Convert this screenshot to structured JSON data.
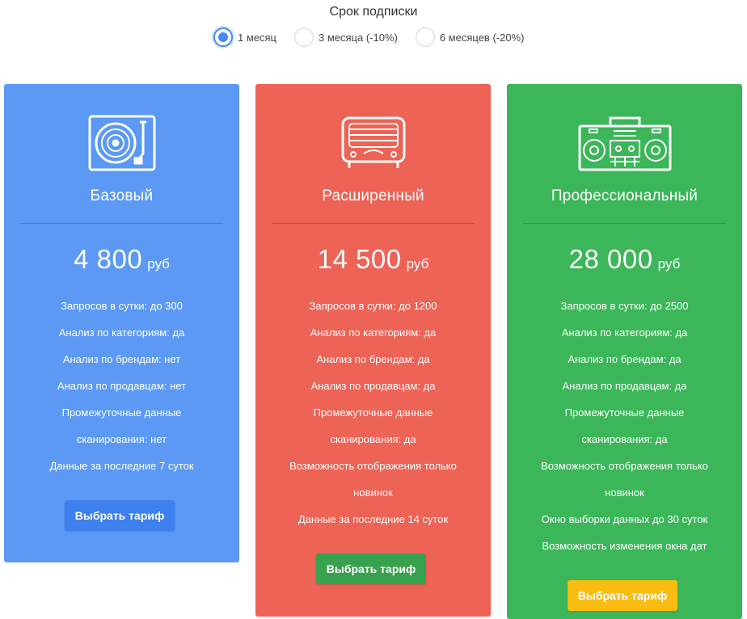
{
  "period": {
    "title": "Срок подписки",
    "options": [
      {
        "label": "1 месяц",
        "selected": true
      },
      {
        "label": "3 месяца (-10%)",
        "selected": false
      },
      {
        "label": "6 месяцев (-20%)",
        "selected": false
      }
    ]
  },
  "plans": [
    {
      "name": "Базовый",
      "icon": "turntable-icon",
      "color": "#5b99f5",
      "price": "4 800",
      "unit": "руб",
      "features": [
        "Запросов в сутки: до 300",
        "Анализ по категориям: да",
        "Анализ по брендам: нет",
        "Анализ по продавцам: нет",
        "Промежуточные данные",
        "сканирования: нет",
        "Данные за последние 7 суток"
      ],
      "button": "Выбрать тариф",
      "button_color": "#3d80ee"
    },
    {
      "name": "Расширенный",
      "icon": "radio-icon",
      "color": "#ed6356",
      "price": "14 500",
      "unit": "руб",
      "features": [
        "Запросов в сутки: до 1200",
        "Анализ по категориям: да",
        "Анализ по брендам: да",
        "Анализ по продавцам: да",
        "Промежуточные данные",
        "сканирования: да",
        "Возможность отображения только",
        "новинок",
        "Данные за последние 14 суток"
      ],
      "button": "Выбрать тариф",
      "button_color": "#38a14d"
    },
    {
      "name": "Профессиональный",
      "icon": "boombox-icon",
      "color": "#3bb659",
      "price": "28 000",
      "unit": "руб",
      "features": [
        "Запросов в сутки: до 2500",
        "Анализ по категориям: да",
        "Анализ по брендам: да",
        "Анализ по продавцам: да",
        "Промежуточные данные",
        "сканирования: да",
        "Возможность отображения только",
        "новинок",
        "Окно выборки данных до 30 суток",
        "Возможность изменения окна дат"
      ],
      "button": "Выбрать тариф",
      "button_color": "#f9bd12"
    }
  ]
}
